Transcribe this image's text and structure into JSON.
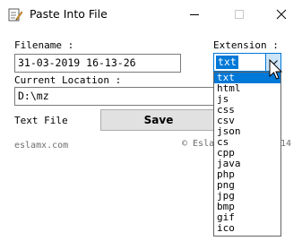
{
  "window": {
    "title": "Paste Into File"
  },
  "form": {
    "filename_label": "Filename :",
    "filename_value": "31-03-2019 16-13-26",
    "location_label": "Current Location :",
    "location_value": "D:\\mz",
    "extension_label": "Extension :",
    "extension_selected": "txt",
    "text_file_label": "Text File",
    "save_label": "Save"
  },
  "footer": {
    "left": "eslamx.com",
    "right_prefix": "© Esla",
    "right_suffix": "14"
  },
  "dropdown": {
    "options": [
      "txt",
      "html",
      "js",
      "css",
      "csv",
      "json",
      "cs",
      "cpp",
      "java",
      "php",
      "png",
      "jpg",
      "bmp",
      "gif",
      "ico"
    ],
    "selected_index": 0
  },
  "colors": {
    "accent": "#0078d7",
    "button_face": "#e1e1e1",
    "arrow_face": "#cce4f7"
  }
}
